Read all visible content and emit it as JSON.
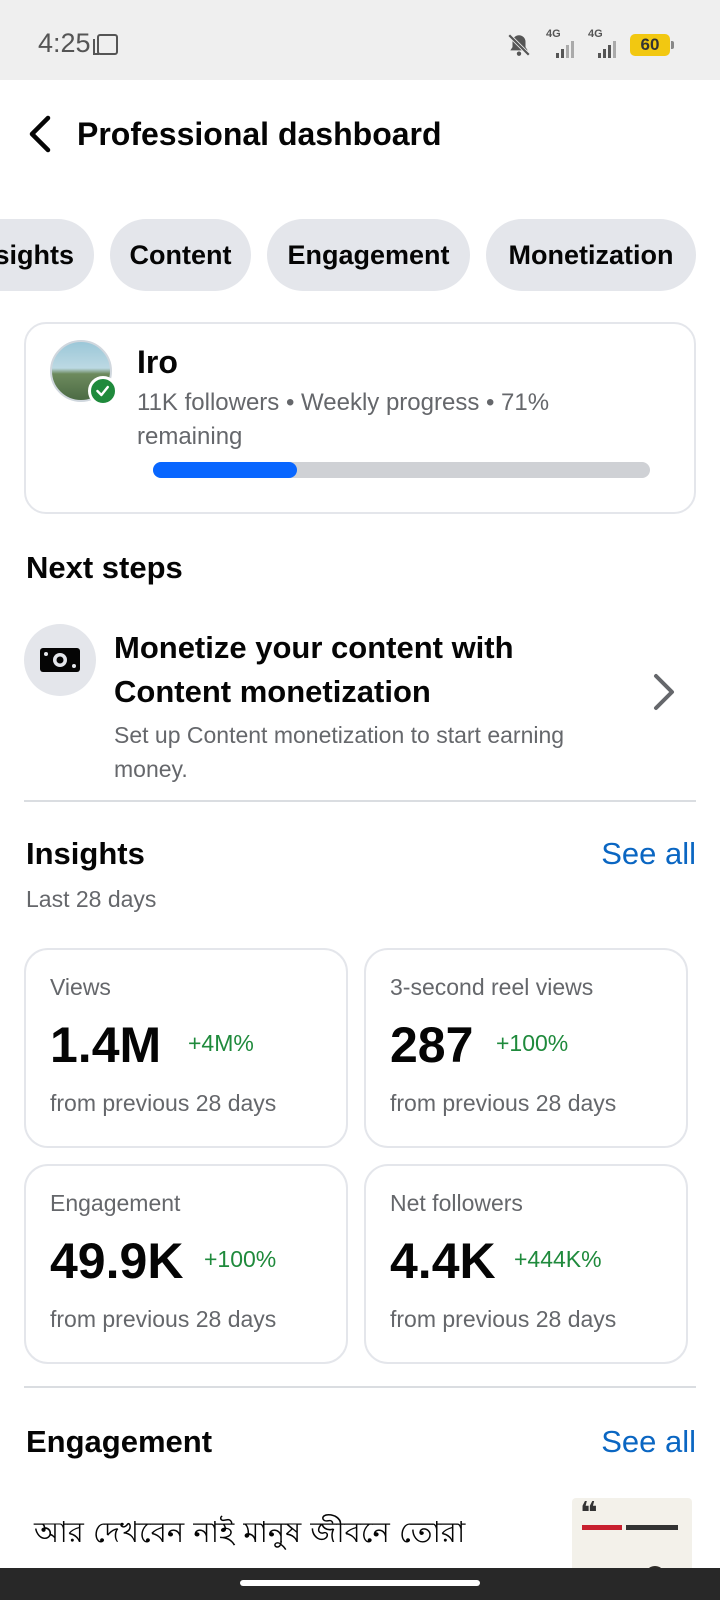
{
  "status_bar": {
    "time": "4:25",
    "network_1": "4G",
    "network_2": "4G",
    "battery": "60"
  },
  "header": {
    "title": "Professional dashboard"
  },
  "tabs": [
    {
      "label": "Insights"
    },
    {
      "label": "Content"
    },
    {
      "label": "Engagement"
    },
    {
      "label": "Monetization"
    }
  ],
  "profile": {
    "name": "Iro",
    "meta": "11K followers • Weekly progress • 71% remaining",
    "weekly_progress": 0.29
  },
  "next_steps": {
    "title": "Next steps",
    "item": {
      "title": "Monetize your content with Content monetization",
      "description": "Set up Content monetization to start earning money."
    }
  },
  "insights": {
    "title": "Insights",
    "see_all": "See all",
    "period": "Last 28 days",
    "cards": [
      {
        "label": "Views",
        "value": "1.4M",
        "change": "+4M%",
        "foot": "from previous 28 days"
      },
      {
        "label": "3-second reel views",
        "value": "287",
        "change": "+100%",
        "foot": "from previous 28 days"
      },
      {
        "label": "Engagement",
        "value": "49.9K",
        "change": "+100%",
        "foot": "from previous 28 days"
      },
      {
        "label": "Net followers",
        "value": "4.4K",
        "change": "+444K%",
        "foot": "from previous 28 days"
      }
    ]
  },
  "engagement": {
    "title": "Engagement",
    "see_all": "See all",
    "post_text": "আর দেখবেন নাই মানুষ জীবনে তোরা"
  },
  "colors": {
    "accent": "#0866ff",
    "link": "#0a66c2",
    "positive": "#1f8a3c"
  }
}
